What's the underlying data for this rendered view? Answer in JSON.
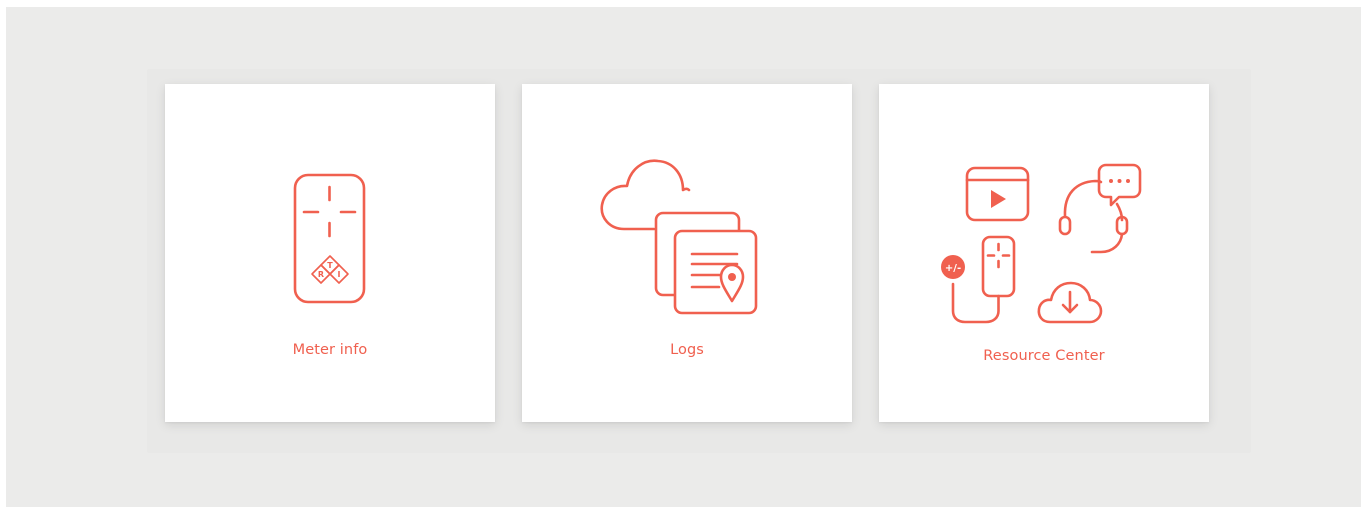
{
  "cards": [
    {
      "label": "Meter info",
      "icon": "meter-device-icon"
    },
    {
      "label": "Logs",
      "icon": "cloud-logs-icon"
    },
    {
      "label": "Resource Center",
      "icon": "resource-center-icon"
    }
  ],
  "meter_logo": {
    "letters": [
      "R",
      "T",
      "I"
    ]
  },
  "resource_badge": "+/-",
  "colors": {
    "accent": "#f0604f",
    "background": "#ebebea",
    "panel": "#e8e8e7",
    "card": "#ffffff"
  }
}
